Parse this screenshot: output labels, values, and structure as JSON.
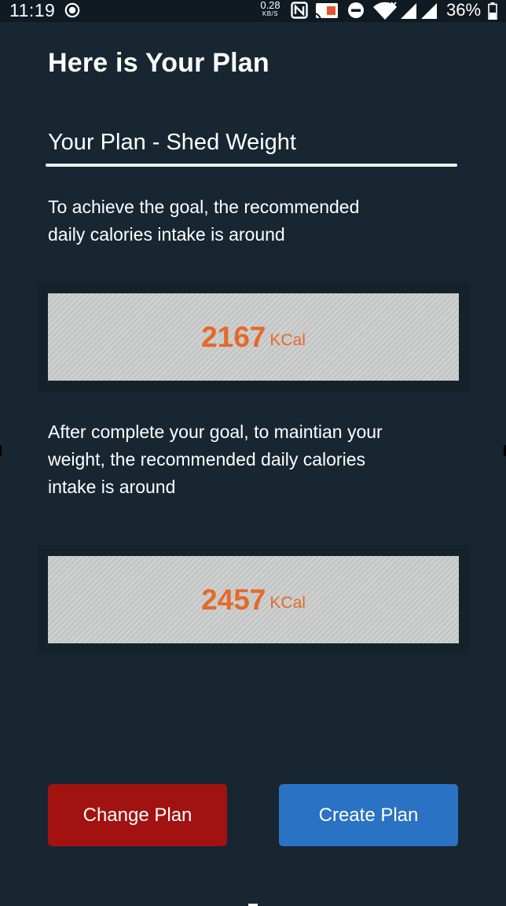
{
  "status_bar": {
    "time": "11:19",
    "net_speed_value": "0.28",
    "net_speed_unit": "KB/S",
    "battery_percent": "36%",
    "icons": [
      "record-icon",
      "nfc-icon",
      "cast-icon",
      "do-not-disturb-icon",
      "wifi-icon",
      "signal-icon",
      "battery-icon"
    ]
  },
  "header": {
    "title": "Here is Your Plan"
  },
  "plan": {
    "name": "Your Plan - Shed Weight"
  },
  "goal_section": {
    "text": "To achieve the goal, the recommended\ndaily calories  intake is around",
    "value": "2167",
    "unit": "KCal"
  },
  "maintain_section": {
    "text": "After complete your goal, to maintian your\nweight, the recommended daily calories\nintake is around",
    "value": "2457",
    "unit": "KCal"
  },
  "actions": {
    "change_label": "Change Plan",
    "create_label": "Create Plan"
  },
  "colors": {
    "background": "#172631",
    "accent_orange": "#e46a2a",
    "change_button": "#a21210",
    "create_button": "#2a72c4",
    "card": "#c4c6c6"
  }
}
